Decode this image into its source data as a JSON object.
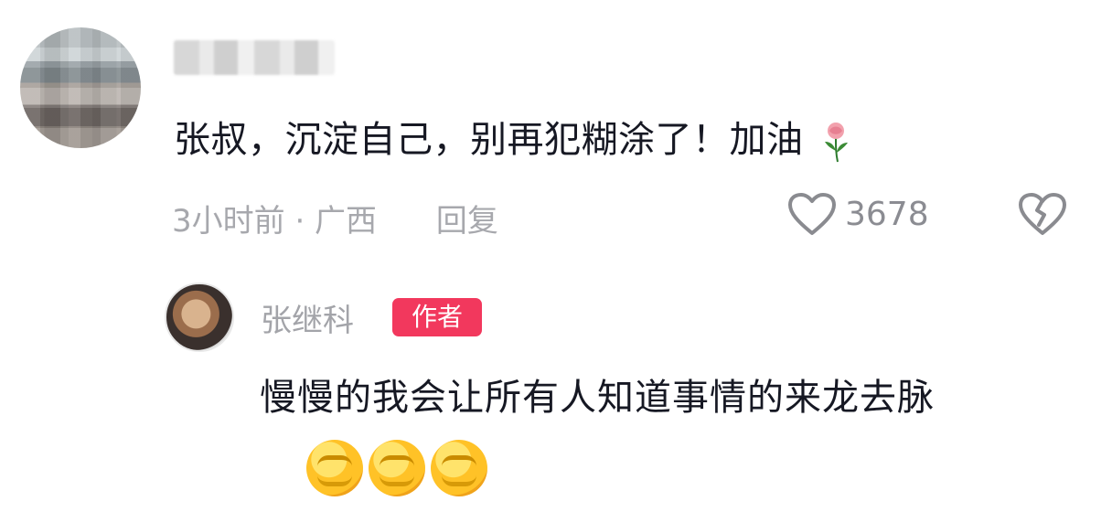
{
  "comment": {
    "text": "张叔，沉淀自己，别再犯糊涂了！加油",
    "time_location": "3小时前 · 广西",
    "reply_label": "回复",
    "like_count": "3678",
    "icons": [
      "rose-emoji-icon",
      "heart-outline-icon",
      "broken-heart-icon"
    ]
  },
  "reply": {
    "author_name": "张继科",
    "author_badge": "作者",
    "text": "慢慢的我会让所有人知道事情的来龙去脉",
    "emoji": [
      "fist-emoji-icon",
      "fist-emoji-icon",
      "fist-emoji-icon"
    ]
  },
  "colors": {
    "badge": "#f2385d",
    "text": "#161823",
    "meta": "#a7a8ad"
  }
}
